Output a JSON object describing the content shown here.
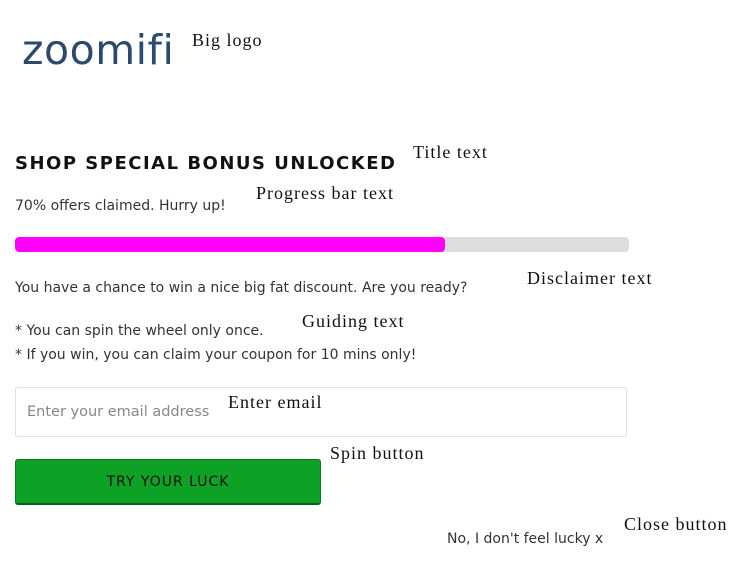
{
  "logo": {
    "text": "zoomifi",
    "color": "#2c4a6e"
  },
  "annotations": {
    "big_logo": "Big logo",
    "title_text": "Title text",
    "progress_bar_text": "Progress bar text",
    "disclaimer_text": "Disclaimer text",
    "guiding_text": "Guiding text",
    "enter_email": "Enter email",
    "spin_button": "Spin button",
    "close_button": "Close button"
  },
  "popup": {
    "title": "SHOP SPECIAL BONUS UNLOCKED",
    "progress_text": "70% offers claimed. Hurry up!",
    "progress": {
      "percent": 70,
      "fill_color": "#ff00ff",
      "track_color": "#dddddd"
    },
    "disclaimer": "You have a chance to win a nice big fat discount. Are you ready?",
    "guide_lines": [
      "* You can spin the wheel only once.",
      "* If you win, you can claim your coupon for 10 mins only!"
    ],
    "email_placeholder": "Enter your email address",
    "spin_button_label": "TRY YOUR LUCK",
    "spin_button_color": "#0da126",
    "close_label": "No, I don't feel lucky x"
  }
}
